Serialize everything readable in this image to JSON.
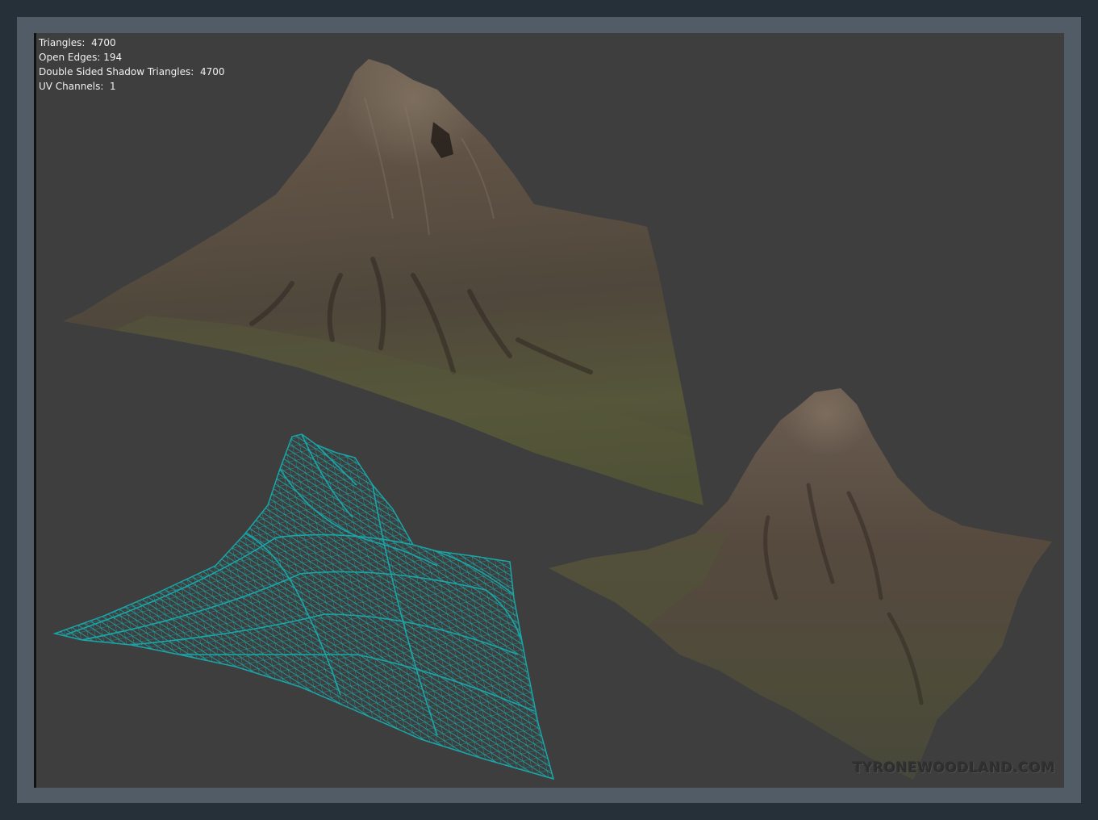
{
  "viewport": {
    "stats": {
      "triangles_label": "Triangles:",
      "triangles_value": "4700",
      "open_edges_label": "Open Edges:",
      "open_edges_value": "194",
      "double_sided_label": "Double Sided Shadow Triangles:",
      "double_sided_value": "4700",
      "uv_channels_label": "UV Channels:",
      "uv_channels_value": "1"
    },
    "watermark": "TYRONEWOODLAND.COM"
  },
  "colors": {
    "background": "#263039",
    "frame": "#515c66",
    "viewport": "#3e3e3e",
    "wireframe": "#19a6a8",
    "rock": "#5a4e43",
    "grass": "#565b38"
  },
  "icons": {
    "main": "mountain-mesh-textured",
    "wire": "mountain-mesh-wireframe",
    "small": "mountain-mesh-textured-small"
  }
}
